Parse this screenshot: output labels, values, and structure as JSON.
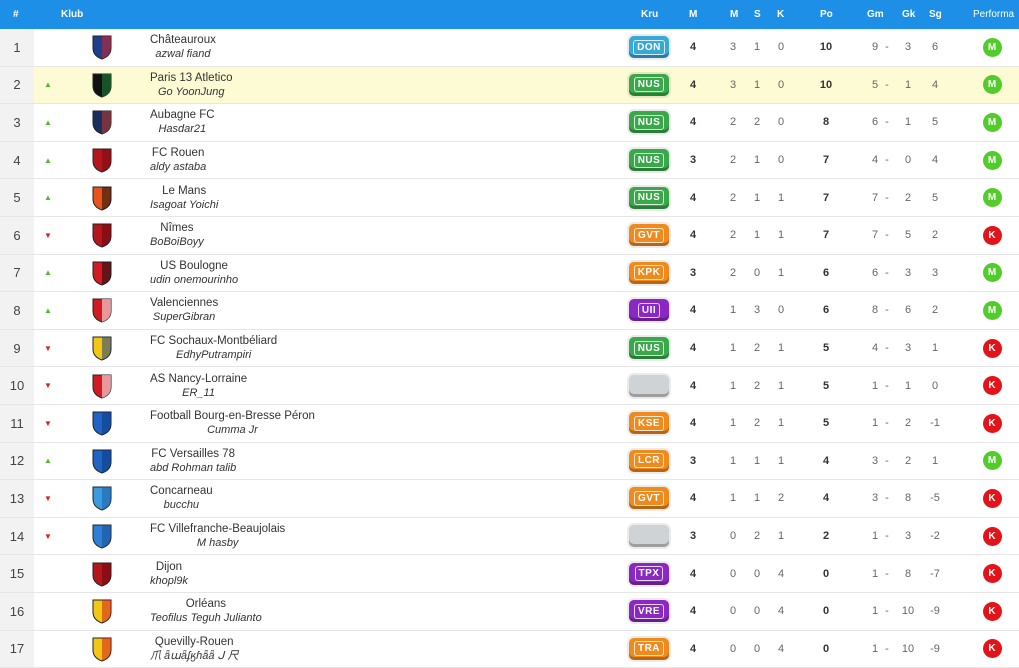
{
  "header": {
    "pos": "#",
    "club": "Klub",
    "kru": "Kru",
    "played": "M",
    "won": "M",
    "drawn": "S",
    "lost": "K",
    "points": "Po",
    "gf": "Gm",
    "ga": "Gk",
    "gd": "Sg",
    "perf": "Performa"
  },
  "colors": {
    "header_bg": "#1e8fe6",
    "win": "#52cc2a",
    "loss": "#e2141a",
    "up": "#4cba2a",
    "down": "#d9221f",
    "highlight": "#fdfbd3"
  },
  "rows": [
    {
      "pos": "1",
      "trend": "",
      "club": "Châteauroux",
      "manager": "azwal fiand",
      "crew": "DON",
      "crew_color": "#37a9d8",
      "p": "4",
      "w": "3",
      "d": "1",
      "l": "0",
      "pts": "10",
      "gf": "9",
      "sep": "-",
      "ga": "3",
      "gd": "6",
      "perf": "M",
      "crest": "#1d3f8c",
      "crest2": "#d1232a"
    },
    {
      "pos": "2",
      "trend": "up",
      "club": "Paris 13 Atletico",
      "manager": "Go YoonJung",
      "crew": "NUS",
      "crew_color": "#3aa84a",
      "p": "4",
      "w": "3",
      "d": "1",
      "l": "0",
      "pts": "10",
      "gf": "5",
      "sep": "-",
      "ga": "1",
      "gd": "4",
      "perf": "M",
      "crest": "#111111",
      "crest2": "#1f8a3a",
      "highlight": true
    },
    {
      "pos": "3",
      "trend": "up",
      "club": "Aubagne FC",
      "manager": "Hasdar21",
      "crew": "NUS",
      "crew_color": "#3aa84a",
      "p": "4",
      "w": "2",
      "d": "2",
      "l": "0",
      "pts": "8",
      "gf": "6",
      "sep": "-",
      "ga": "1",
      "gd": "5",
      "perf": "M",
      "crest": "#1b2f5e",
      "crest2": "#c0392b"
    },
    {
      "pos": "4",
      "trend": "up",
      "club": "FC Rouen",
      "manager": "aldy astaba",
      "crew": "NUS",
      "crew_color": "#3aa84a",
      "p": "3",
      "w": "2",
      "d": "1",
      "l": "0",
      "pts": "7",
      "gf": "4",
      "sep": "-",
      "ga": "0",
      "gd": "4",
      "perf": "M",
      "crest": "#b3161d",
      "crest2": "#7a0d12"
    },
    {
      "pos": "5",
      "trend": "up",
      "club": "Le Mans",
      "manager": "Isagoat Yoichi",
      "crew": "NUS",
      "crew_color": "#3aa84a",
      "p": "4",
      "w": "2",
      "d": "1",
      "l": "1",
      "pts": "7",
      "gf": "7",
      "sep": "-",
      "ga": "2",
      "gd": "5",
      "perf": "M",
      "crest": "#e8541b",
      "crest2": "#111111"
    },
    {
      "pos": "6",
      "trend": "down",
      "club": "Nîmes",
      "manager": "BoBoiBoyy",
      "crew": "GVT",
      "crew_color": "#f08a1c",
      "p": "4",
      "w": "2",
      "d": "1",
      "l": "1",
      "pts": "7",
      "gf": "7",
      "sep": "-",
      "ga": "5",
      "gd": "2",
      "perf": "K",
      "crest": "#b3161d",
      "crest2": "#6a0a0e"
    },
    {
      "pos": "7",
      "trend": "up",
      "club": "US Boulogne",
      "manager": "udin onemourinho",
      "crew": "KPK",
      "crew_color": "#f08a1c",
      "p": "3",
      "w": "2",
      "d": "0",
      "l": "1",
      "pts": "6",
      "gf": "6",
      "sep": "-",
      "ga": "3",
      "gd": "3",
      "perf": "M",
      "crest": "#d11a22",
      "crest2": "#111111"
    },
    {
      "pos": "8",
      "trend": "up",
      "club": "Valenciennes",
      "manager": "SuperGibran",
      "crew": "UII",
      "crew_color": "#8b27c2",
      "p": "4",
      "w": "1",
      "d": "3",
      "l": "0",
      "pts": "6",
      "gf": "8",
      "sep": "-",
      "ga": "6",
      "gd": "2",
      "perf": "M",
      "crest": "#d11a22",
      "crest2": "#ffffff"
    },
    {
      "pos": "9",
      "trend": "down",
      "club": "FC Sochaux-Montbéliard",
      "manager": "EdhyPutrampiri",
      "crew": "NUS",
      "crew_color": "#3aa84a",
      "p": "4",
      "w": "1",
      "d": "2",
      "l": "1",
      "pts": "5",
      "gf": "4",
      "sep": "-",
      "ga": "3",
      "gd": "1",
      "perf": "K",
      "crest": "#f2c713",
      "crest2": "#1d3f8c"
    },
    {
      "pos": "10",
      "trend": "down",
      "club": "AS Nancy-Lorraine",
      "manager": "ER_11",
      "crew": "",
      "crew_color": "#d0d3d6",
      "p": "4",
      "w": "1",
      "d": "2",
      "l": "1",
      "pts": "5",
      "gf": "1",
      "sep": "-",
      "ga": "1",
      "gd": "0",
      "perf": "K",
      "crest": "#d11a22",
      "crest2": "#ffffff"
    },
    {
      "pos": "11",
      "trend": "down",
      "club": "Football Bourg-en-Bresse Péron",
      "manager": "Cumma Jr",
      "crew": "KSE",
      "crew_color": "#f08a1c",
      "p": "4",
      "w": "1",
      "d": "2",
      "l": "1",
      "pts": "5",
      "gf": "1",
      "sep": "-",
      "ga": "2",
      "gd": "-1",
      "perf": "K",
      "crest": "#1f63c4",
      "crest2": "#0e3b80"
    },
    {
      "pos": "12",
      "trend": "up",
      "club": "FC Versailles 78",
      "manager": "abd Rohman talib",
      "crew": "LCR",
      "crew_color": "#f08a1c",
      "p": "3",
      "w": "1",
      "d": "1",
      "l": "1",
      "pts": "4",
      "gf": "3",
      "sep": "-",
      "ga": "2",
      "gd": "1",
      "perf": "M",
      "crest": "#1f63c4",
      "crest2": "#0e3b80"
    },
    {
      "pos": "13",
      "trend": "down",
      "club": "Concarneau",
      "manager": "bucchu",
      "crew": "GVT",
      "crew_color": "#f08a1c",
      "p": "4",
      "w": "1",
      "d": "1",
      "l": "2",
      "pts": "4",
      "gf": "3",
      "sep": "-",
      "ga": "8",
      "gd": "-5",
      "perf": "K",
      "crest": "#3a9be0",
      "crest2": "#1d5fa8"
    },
    {
      "pos": "14",
      "trend": "down",
      "club": "FC Villefranche-Beaujolais",
      "manager": "M hasby",
      "crew": "",
      "crew_color": "#d0d3d6",
      "p": "3",
      "w": "0",
      "d": "2",
      "l": "1",
      "pts": "2",
      "gf": "1",
      "sep": "-",
      "ga": "3",
      "gd": "-2",
      "perf": "K",
      "crest": "#2f7fd6",
      "crest2": "#1a4e96"
    },
    {
      "pos": "15",
      "trend": "",
      "club": "Dijon",
      "manager": "khopl9k",
      "crew": "TPX",
      "crew_color": "#8b27c2",
      "p": "4",
      "w": "0",
      "d": "0",
      "l": "4",
      "pts": "0",
      "gf": "1",
      "sep": "-",
      "ga": "8",
      "gd": "-7",
      "perf": "K",
      "crest": "#b3161d",
      "crest2": "#6a0a0e"
    },
    {
      "pos": "16",
      "trend": "",
      "club": "Orléans",
      "manager": "Teofilus Teguh Julianto",
      "crew": "VRE",
      "crew_color": "#8b27c2",
      "p": "4",
      "w": "0",
      "d": "0",
      "l": "4",
      "pts": "0",
      "gf": "1",
      "sep": "-",
      "ga": "10",
      "gd": "-9",
      "perf": "K",
      "crest": "#f2c713",
      "crest2": "#d11a22"
    },
    {
      "pos": "17",
      "trend": "",
      "club": "Quevilly-Rouen",
      "manager": "爪 ǟաǟʄӄɦǟǟ ᒍ 尺",
      "crew": "TRA",
      "crew_color": "#f08a1c",
      "p": "4",
      "w": "0",
      "d": "0",
      "l": "4",
      "pts": "0",
      "gf": "1",
      "sep": "-",
      "ga": "10",
      "gd": "-9",
      "perf": "K",
      "crest": "#f2c713",
      "crest2": "#d11a22"
    }
  ]
}
